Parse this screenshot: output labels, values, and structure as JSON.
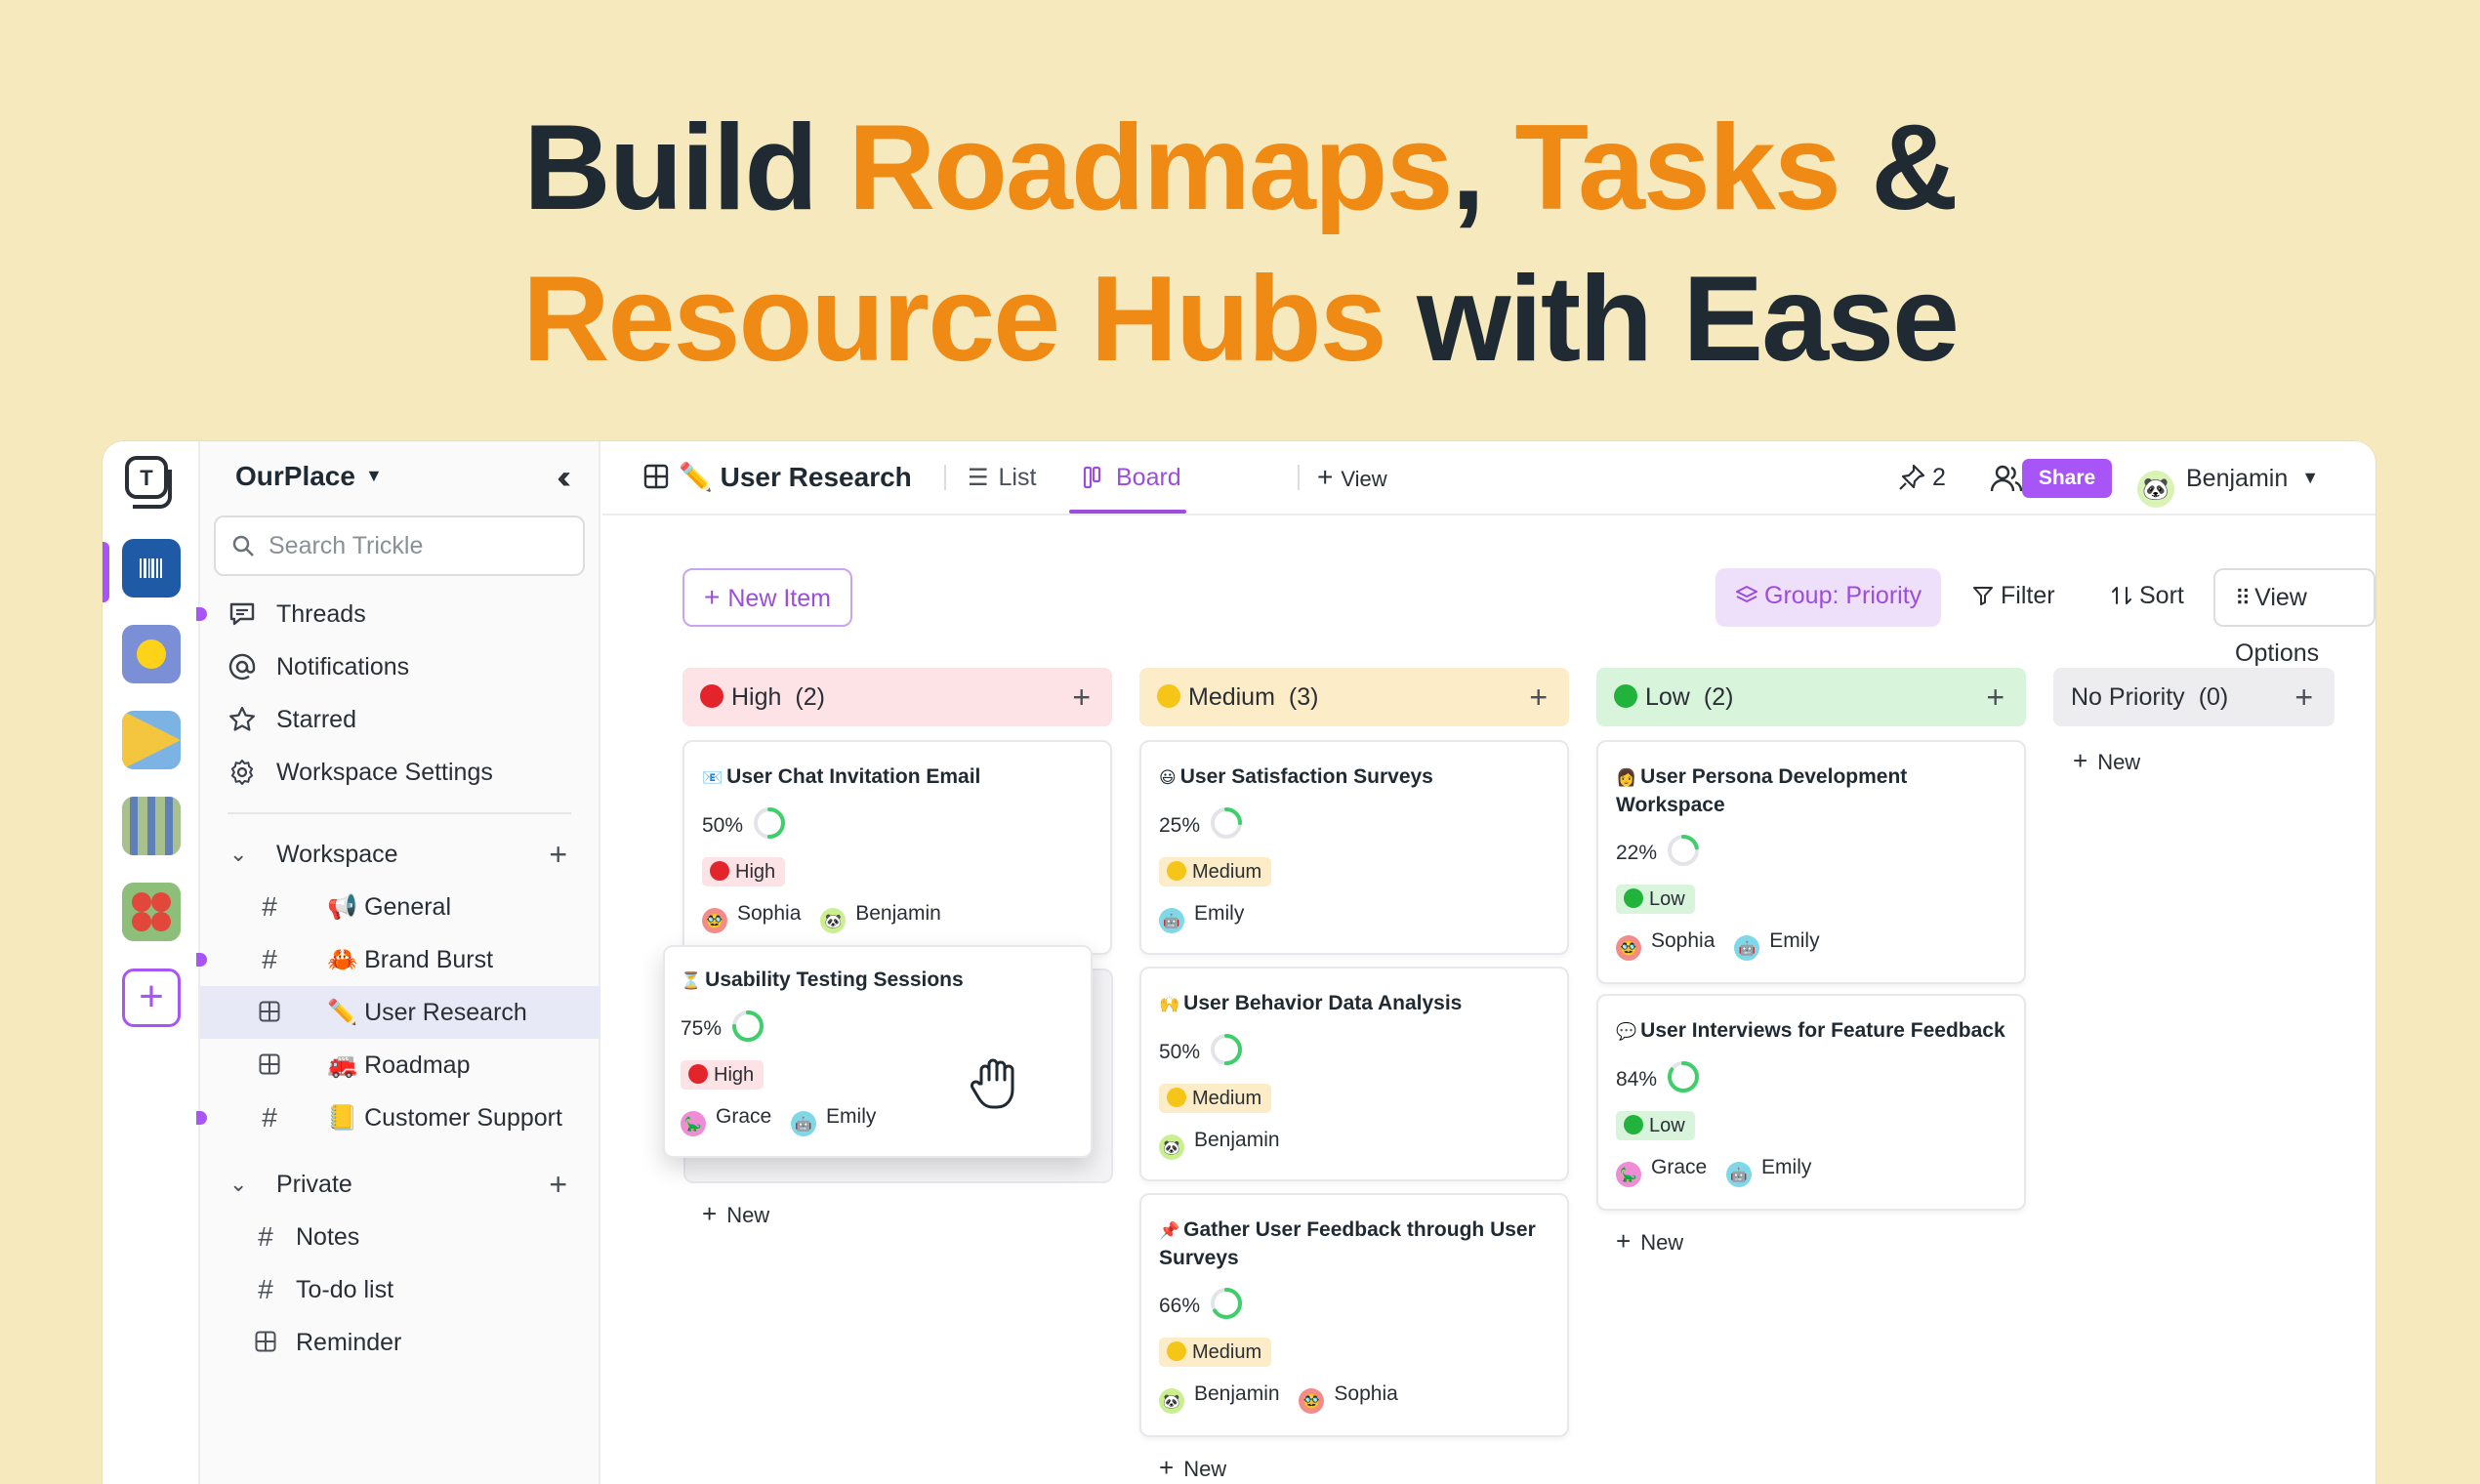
{
  "hero": {
    "w1": "Build ",
    "w2": "Roadmaps",
    "w3": ", ",
    "w4": "Tasks",
    "w5": " &",
    "w6": "Resource Hubs",
    "w7": " with Ease"
  },
  "colors": {
    "accent": "#a855f7",
    "hero_accent": "#ef8a15",
    "background": "#f6e9bd",
    "high": "#e3242b",
    "medium": "#f5c518",
    "low": "#21b33b"
  },
  "rail": {
    "workspaces": [
      "barcode-workspace-icon",
      "sun-workspace-icon",
      "play-workspace-icon",
      "stripes-workspace-icon",
      "dots-workspace-icon"
    ],
    "add_label": "+"
  },
  "sidebar": {
    "workspace_name": "OurPlace",
    "search_placeholder": "Search Trickle",
    "nav": [
      {
        "label": "Threads",
        "icon": "chat-icon",
        "unread": true
      },
      {
        "label": "Notifications",
        "icon": "at-icon"
      },
      {
        "label": "Starred",
        "icon": "star-icon"
      },
      {
        "label": "Workspace Settings",
        "icon": "gear-icon"
      }
    ],
    "workspace_section": "Workspace",
    "channels": [
      {
        "label": "📢 General",
        "type": "hash"
      },
      {
        "label": "🦀 Brand Burst",
        "type": "hash",
        "unread": true
      },
      {
        "label": "✏️ User Research",
        "type": "grid",
        "selected": true
      },
      {
        "label": "🚒 Roadmap",
        "type": "grid"
      },
      {
        "label": "📒 Customer Support",
        "type": "hash",
        "unread": true
      }
    ],
    "private_section": "Private",
    "private_items": [
      {
        "label": "Notes",
        "type": "hash"
      },
      {
        "label": "To-do list",
        "type": "hash"
      },
      {
        "label": "Reminder",
        "type": "grid"
      }
    ]
  },
  "topbar": {
    "title": "✏️ User Research",
    "tab_list": "List",
    "tab_board": "Board",
    "add_view": "View",
    "pin_count": "2",
    "share": "Share",
    "user": "Benjamin"
  },
  "toolbar": {
    "new_item": "New Item",
    "group": "Group: Priority",
    "filter": "Filter",
    "sort": "Sort",
    "view_options": "View Options"
  },
  "columns": [
    {
      "name": "High",
      "count": "(2)",
      "bg": "#fde2e6",
      "dot": "#e3242b"
    },
    {
      "name": "Medium",
      "count": "(3)",
      "bg": "#fdecc8",
      "dot": "#f5c518"
    },
    {
      "name": "Low",
      "count": "(2)",
      "bg": "#d8f5dc",
      "dot": "#21b33b"
    },
    {
      "name": "No Priority",
      "count": "(0)",
      "bg": "#ededf0",
      "dot": ""
    }
  ],
  "cards": {
    "high_0": {
      "emoji": "📧",
      "title": "User Chat Invitation Email",
      "progress": "50%",
      "progress_value": 0.5,
      "priority": "High",
      "people": [
        "Sophia",
        "Benjamin"
      ]
    },
    "high_1": {
      "emoji": "⏳",
      "title": "Usability Testing Sessions",
      "progress": "75%",
      "progress_value": 0.75,
      "priority": "High",
      "people": [
        "Grace",
        "Emily"
      ]
    },
    "med_0": {
      "emoji": "😃",
      "title": "User Satisfaction Surveys",
      "progress": "25%",
      "progress_value": 0.25,
      "priority": "Medium",
      "people": [
        "Emily"
      ]
    },
    "med_1": {
      "emoji": "🙌",
      "title": "User Behavior Data Analysis",
      "progress": "50%",
      "progress_value": 0.5,
      "priority": "Medium",
      "people": [
        "Benjamin"
      ]
    },
    "med_2": {
      "emoji": "📌",
      "title": "Gather User Feedback through User Surveys",
      "progress": "66%",
      "progress_value": 0.66,
      "priority": "Medium",
      "people": [
        "Benjamin",
        "Sophia"
      ]
    },
    "low_0": {
      "emoji": "👩",
      "title": "User Persona Development Workspace",
      "progress": "22%",
      "progress_value": 0.22,
      "priority": "Low",
      "people": [
        "Sophia",
        "Emily"
      ]
    },
    "low_1": {
      "emoji": "💬",
      "title": "User Interviews for Feature Feedback",
      "progress": "84%",
      "progress_value": 0.84,
      "priority": "Low",
      "people": [
        "Grace",
        "Emily"
      ]
    }
  },
  "new_label": "New"
}
